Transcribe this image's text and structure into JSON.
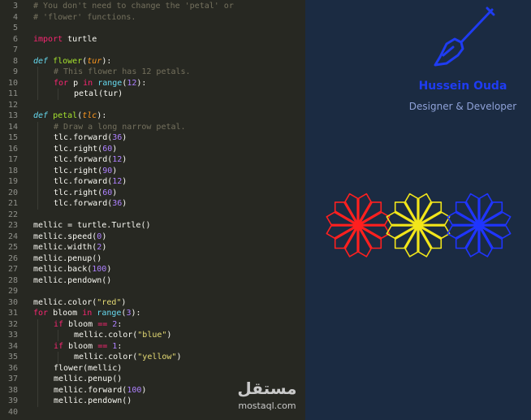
{
  "editor": {
    "lines": [
      {
        "n": "3",
        "indent": 0,
        "tokens": [
          {
            "t": "# You don't need to change the 'petal' or",
            "c": "cm"
          }
        ]
      },
      {
        "n": "4",
        "indent": 0,
        "tokens": [
          {
            "t": "# 'flower' functions.",
            "c": "cm"
          }
        ]
      },
      {
        "n": "5",
        "indent": 0,
        "tokens": []
      },
      {
        "n": "6",
        "indent": 0,
        "tokens": [
          {
            "t": "import",
            "c": "k"
          },
          {
            "t": " turtle",
            "c": ""
          }
        ]
      },
      {
        "n": "7",
        "indent": 0,
        "tokens": []
      },
      {
        "n": "8",
        "indent": 0,
        "tokens": [
          {
            "t": "def",
            "c": "kd"
          },
          {
            "t": " ",
            "c": ""
          },
          {
            "t": "flower",
            "c": "fn"
          },
          {
            "t": "(",
            "c": ""
          },
          {
            "t": "tur",
            "c": "pa"
          },
          {
            "t": "):",
            "c": ""
          }
        ]
      },
      {
        "n": "9",
        "indent": 1,
        "tokens": [
          {
            "t": "# This flower has 12 petals.",
            "c": "cm"
          }
        ]
      },
      {
        "n": "10",
        "indent": 1,
        "tokens": [
          {
            "t": "for",
            "c": "k"
          },
          {
            "t": " p ",
            "c": ""
          },
          {
            "t": "in",
            "c": "k"
          },
          {
            "t": " ",
            "c": ""
          },
          {
            "t": "range",
            "c": "bi"
          },
          {
            "t": "(",
            "c": ""
          },
          {
            "t": "12",
            "c": "num"
          },
          {
            "t": "):",
            "c": ""
          }
        ]
      },
      {
        "n": "11",
        "indent": 2,
        "tokens": [
          {
            "t": "petal(tur)",
            "c": ""
          }
        ]
      },
      {
        "n": "12",
        "indent": 0,
        "tokens": []
      },
      {
        "n": "13",
        "indent": 0,
        "tokens": [
          {
            "t": "def",
            "c": "kd"
          },
          {
            "t": " ",
            "c": ""
          },
          {
            "t": "petal",
            "c": "fn"
          },
          {
            "t": "(",
            "c": ""
          },
          {
            "t": "tlc",
            "c": "pa"
          },
          {
            "t": "):",
            "c": ""
          }
        ]
      },
      {
        "n": "14",
        "indent": 1,
        "tokens": [
          {
            "t": "# Draw a long narrow petal.",
            "c": "cm"
          }
        ]
      },
      {
        "n": "15",
        "indent": 1,
        "tokens": [
          {
            "t": "tlc.forward(",
            "c": ""
          },
          {
            "t": "36",
            "c": "num"
          },
          {
            "t": ")",
            "c": ""
          }
        ]
      },
      {
        "n": "16",
        "indent": 1,
        "tokens": [
          {
            "t": "tlc.right(",
            "c": ""
          },
          {
            "t": "60",
            "c": "num"
          },
          {
            "t": ")",
            "c": ""
          }
        ]
      },
      {
        "n": "17",
        "indent": 1,
        "tokens": [
          {
            "t": "tlc.forward(",
            "c": ""
          },
          {
            "t": "12",
            "c": "num"
          },
          {
            "t": ")",
            "c": ""
          }
        ]
      },
      {
        "n": "18",
        "indent": 1,
        "tokens": [
          {
            "t": "tlc.right(",
            "c": ""
          },
          {
            "t": "90",
            "c": "num"
          },
          {
            "t": ")",
            "c": ""
          }
        ]
      },
      {
        "n": "19",
        "indent": 1,
        "tokens": [
          {
            "t": "tlc.forward(",
            "c": ""
          },
          {
            "t": "12",
            "c": "num"
          },
          {
            "t": ")",
            "c": ""
          }
        ]
      },
      {
        "n": "20",
        "indent": 1,
        "tokens": [
          {
            "t": "tlc.right(",
            "c": ""
          },
          {
            "t": "60",
            "c": "num"
          },
          {
            "t": ")",
            "c": ""
          }
        ]
      },
      {
        "n": "21",
        "indent": 1,
        "tokens": [
          {
            "t": "tlc.forward(",
            "c": ""
          },
          {
            "t": "36",
            "c": "num"
          },
          {
            "t": ")",
            "c": ""
          }
        ]
      },
      {
        "n": "22",
        "indent": 0,
        "tokens": []
      },
      {
        "n": "23",
        "indent": 0,
        "tokens": [
          {
            "t": "mellic = turtle.Turtle()",
            "c": ""
          }
        ]
      },
      {
        "n": "24",
        "indent": 0,
        "tokens": [
          {
            "t": "mellic.speed(",
            "c": ""
          },
          {
            "t": "0",
            "c": "num"
          },
          {
            "t": ")",
            "c": ""
          }
        ]
      },
      {
        "n": "25",
        "indent": 0,
        "tokens": [
          {
            "t": "mellic.width(",
            "c": ""
          },
          {
            "t": "2",
            "c": "num"
          },
          {
            "t": ")",
            "c": ""
          }
        ]
      },
      {
        "n": "26",
        "indent": 0,
        "tokens": [
          {
            "t": "mellic.penup()",
            "c": ""
          }
        ]
      },
      {
        "n": "27",
        "indent": 0,
        "tokens": [
          {
            "t": "mellic.back(",
            "c": ""
          },
          {
            "t": "100",
            "c": "num"
          },
          {
            "t": ")",
            "c": ""
          }
        ]
      },
      {
        "n": "28",
        "indent": 0,
        "tokens": [
          {
            "t": "mellic.pendown()",
            "c": ""
          }
        ]
      },
      {
        "n": "29",
        "indent": 0,
        "tokens": []
      },
      {
        "n": "30",
        "indent": 0,
        "tokens": [
          {
            "t": "mellic.color(",
            "c": ""
          },
          {
            "t": "\"red\"",
            "c": "str"
          },
          {
            "t": ")",
            "c": ""
          }
        ]
      },
      {
        "n": "31",
        "indent": 0,
        "tokens": [
          {
            "t": "for",
            "c": "k"
          },
          {
            "t": " bloom ",
            "c": ""
          },
          {
            "t": "in",
            "c": "k"
          },
          {
            "t": " ",
            "c": ""
          },
          {
            "t": "range",
            "c": "bi"
          },
          {
            "t": "(",
            "c": ""
          },
          {
            "t": "3",
            "c": "num"
          },
          {
            "t": "):",
            "c": ""
          }
        ]
      },
      {
        "n": "32",
        "indent": 1,
        "tokens": [
          {
            "t": "if",
            "c": "k"
          },
          {
            "t": " bloom ",
            "c": ""
          },
          {
            "t": "==",
            "c": "k"
          },
          {
            "t": " ",
            "c": ""
          },
          {
            "t": "2",
            "c": "num"
          },
          {
            "t": ":",
            "c": ""
          }
        ]
      },
      {
        "n": "33",
        "indent": 2,
        "tokens": [
          {
            "t": "mellic.color(",
            "c": ""
          },
          {
            "t": "\"blue\"",
            "c": "str"
          },
          {
            "t": ")",
            "c": ""
          }
        ]
      },
      {
        "n": "34",
        "indent": 1,
        "tokens": [
          {
            "t": "if",
            "c": "k"
          },
          {
            "t": " bloom ",
            "c": ""
          },
          {
            "t": "==",
            "c": "k"
          },
          {
            "t": " ",
            "c": ""
          },
          {
            "t": "1",
            "c": "num"
          },
          {
            "t": ":",
            "c": ""
          }
        ]
      },
      {
        "n": "35",
        "indent": 2,
        "tokens": [
          {
            "t": "mellic.color(",
            "c": ""
          },
          {
            "t": "\"yellow\"",
            "c": "str"
          },
          {
            "t": ")",
            "c": ""
          }
        ]
      },
      {
        "n": "36",
        "indent": 1,
        "tokens": [
          {
            "t": "flower(mellic)",
            "c": ""
          }
        ]
      },
      {
        "n": "37",
        "indent": 1,
        "tokens": [
          {
            "t": "mellic.penup()",
            "c": ""
          }
        ]
      },
      {
        "n": "38",
        "indent": 1,
        "tokens": [
          {
            "t": "mellic.forward(",
            "c": ""
          },
          {
            "t": "100",
            "c": "num"
          },
          {
            "t": ")",
            "c": ""
          }
        ]
      },
      {
        "n": "39",
        "indent": 1,
        "tokens": [
          {
            "t": "mellic.pendown()",
            "c": ""
          }
        ]
      },
      {
        "n": "40",
        "indent": 0,
        "tokens": []
      }
    ]
  },
  "branding": {
    "name": "Hussein Ouda",
    "role": "Designer & Developer",
    "icon": "paintbrush-icon",
    "accent": "#1f3cf2"
  },
  "flowers": [
    {
      "color": "#ff1f1f",
      "icon": "red-flower"
    },
    {
      "color": "#f2e61a",
      "icon": "yellow-flower"
    },
    {
      "color": "#1f35ff",
      "icon": "blue-flower"
    }
  ],
  "watermark": {
    "arabic": "مستقل",
    "latin": "mostaql.com"
  }
}
